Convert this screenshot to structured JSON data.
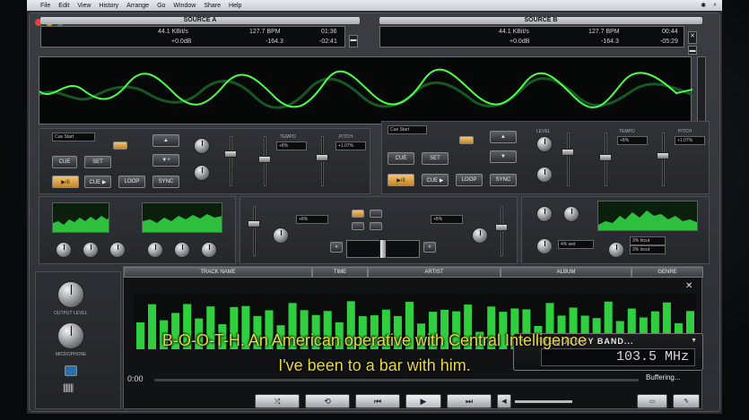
{
  "menubar": {
    "apple": "",
    "items": [
      "File",
      "Edit",
      "View",
      "History",
      "Arrange",
      "Go",
      "Window",
      "Share",
      "Help"
    ]
  },
  "source_a": {
    "title": "SOURCE A",
    "bitrate": "44.1 KBit/s",
    "bpm": "127.7 BPM",
    "time_elapsed": "01:36",
    "gain": "+0.0dB",
    "pitch_val": "-164.3",
    "time_remaining": "-02:41"
  },
  "source_b": {
    "title": "SOURCE B",
    "bitrate": "44.1 KBit/s",
    "bpm": "127.7 BPM",
    "time_elapsed": "00:44",
    "gain": "+0.0dB",
    "pitch_val": "-164.3",
    "time_remaining": "-05:29"
  },
  "deck_controls": {
    "cue": "CUE",
    "set": "SET",
    "play_pause": "▶/II",
    "cue_play": "CUE ▶",
    "loop": "LOOP",
    "sync": "SYNC",
    "cue_start": "Cue Start",
    "tempo": "TEMPO",
    "pitch": "PITCH",
    "level": "LEVEL",
    "tempo_val": "+8%",
    "pitch_val": "+1.07%"
  },
  "mixer": {
    "level_val": "+8%",
    "wet": "4% wet",
    "dry": "3% dry",
    "hi_cut": "3% hicut",
    "lo_cut": "3% locut"
  },
  "left_strip": {
    "output_level": "OUTPUT LEVEL",
    "microphone": "MICROPHONE"
  },
  "browser": {
    "columns": [
      "TRACK NAME",
      "TIME",
      "ARTIST",
      "ALBUM",
      "GENRE"
    ],
    "time_display": "0:00",
    "status": "Buffering...",
    "freq_title": "FREQUENCY BAND...",
    "freq_value": "103.5 MHz"
  },
  "transport": {
    "shuffle": "⤨",
    "repeat": "⟲",
    "prev": "⏮",
    "play": "▶",
    "next": "⏭",
    "volume_icon": "◀"
  },
  "subtitles": {
    "line1": "B-O-O-T-H. An American operative with Central Intelligence",
    "line2": "I've been to a bar with him."
  }
}
